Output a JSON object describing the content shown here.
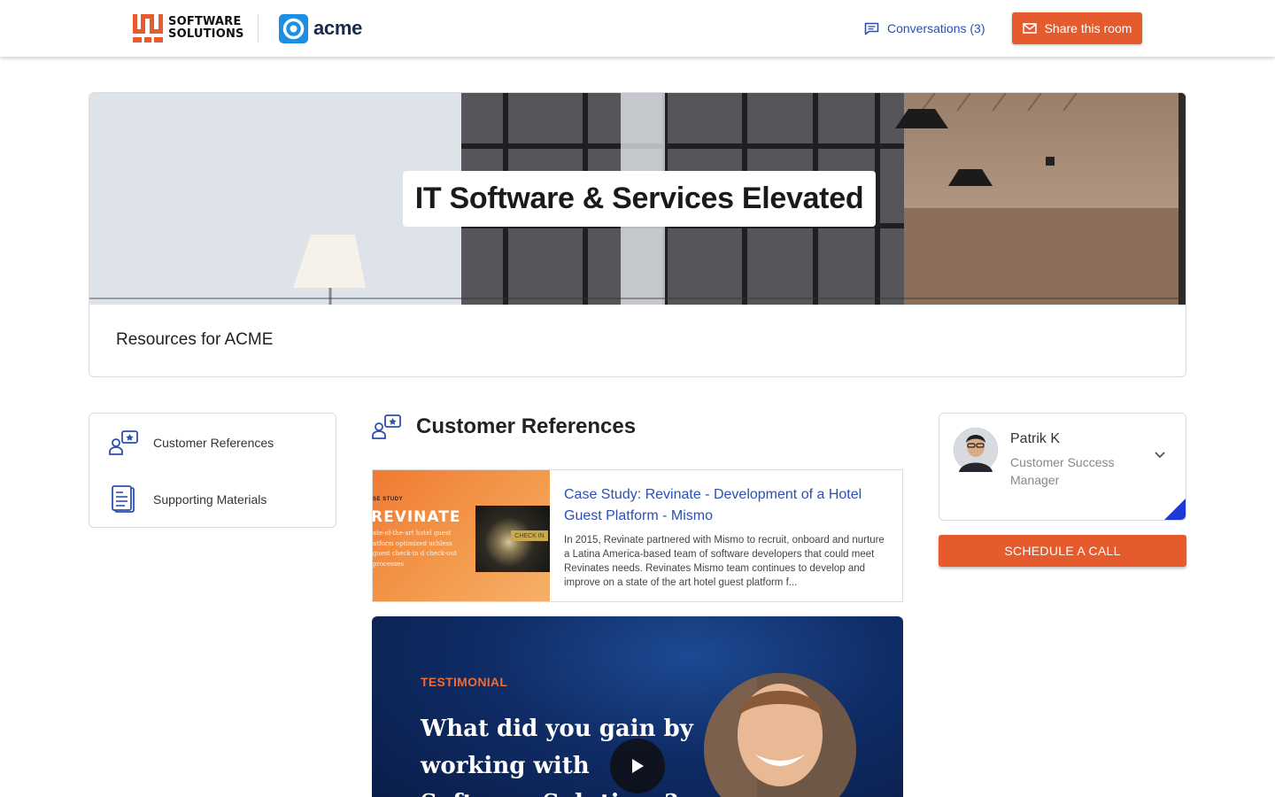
{
  "header": {
    "brand_line1": "SOFTWARE",
    "brand_line2": "SOLUTIONS",
    "client_logo_text": "acme",
    "conversations_label": "Conversations (3)",
    "share_label": "Share this room",
    "accent_color": "#e55b2d",
    "link_color": "#2b4fb3"
  },
  "hero": {
    "title": "IT Software & Services Elevated",
    "resources_title": "Resources for ACME"
  },
  "sidebar": {
    "items": [
      {
        "label": "Customer References",
        "icon": "customer-references-icon"
      },
      {
        "label": "Supporting Materials",
        "icon": "document-icon"
      }
    ]
  },
  "main": {
    "section_title": "Customer References",
    "case_study": {
      "thumb_kicker": "SE STUDY",
      "thumb_title": "REVINATE",
      "thumb_blurb": "ate-of-the-art hotel guest atform optimized uchless guest check-in d check-out processes",
      "thumb_tag": "CHECK IN",
      "title": "Case Study: Revinate - Development of a Hotel Guest Platform - Mismo",
      "description": "In 2015, Revinate partnered with Mismo to recruit, onboard and nurture a Latina America-based team of software developers that could meet Revinates needs. Revinates Mismo team continues to develop and improve on a state of the art hotel guest platform f..."
    },
    "testimonial": {
      "kicker": "TESTIMONIAL",
      "question": "What did you gain by working with Software Solutions?"
    }
  },
  "contact": {
    "name": "Patrik K",
    "role": "Customer Success Manager",
    "schedule_label": "SCHEDULE A CALL"
  }
}
